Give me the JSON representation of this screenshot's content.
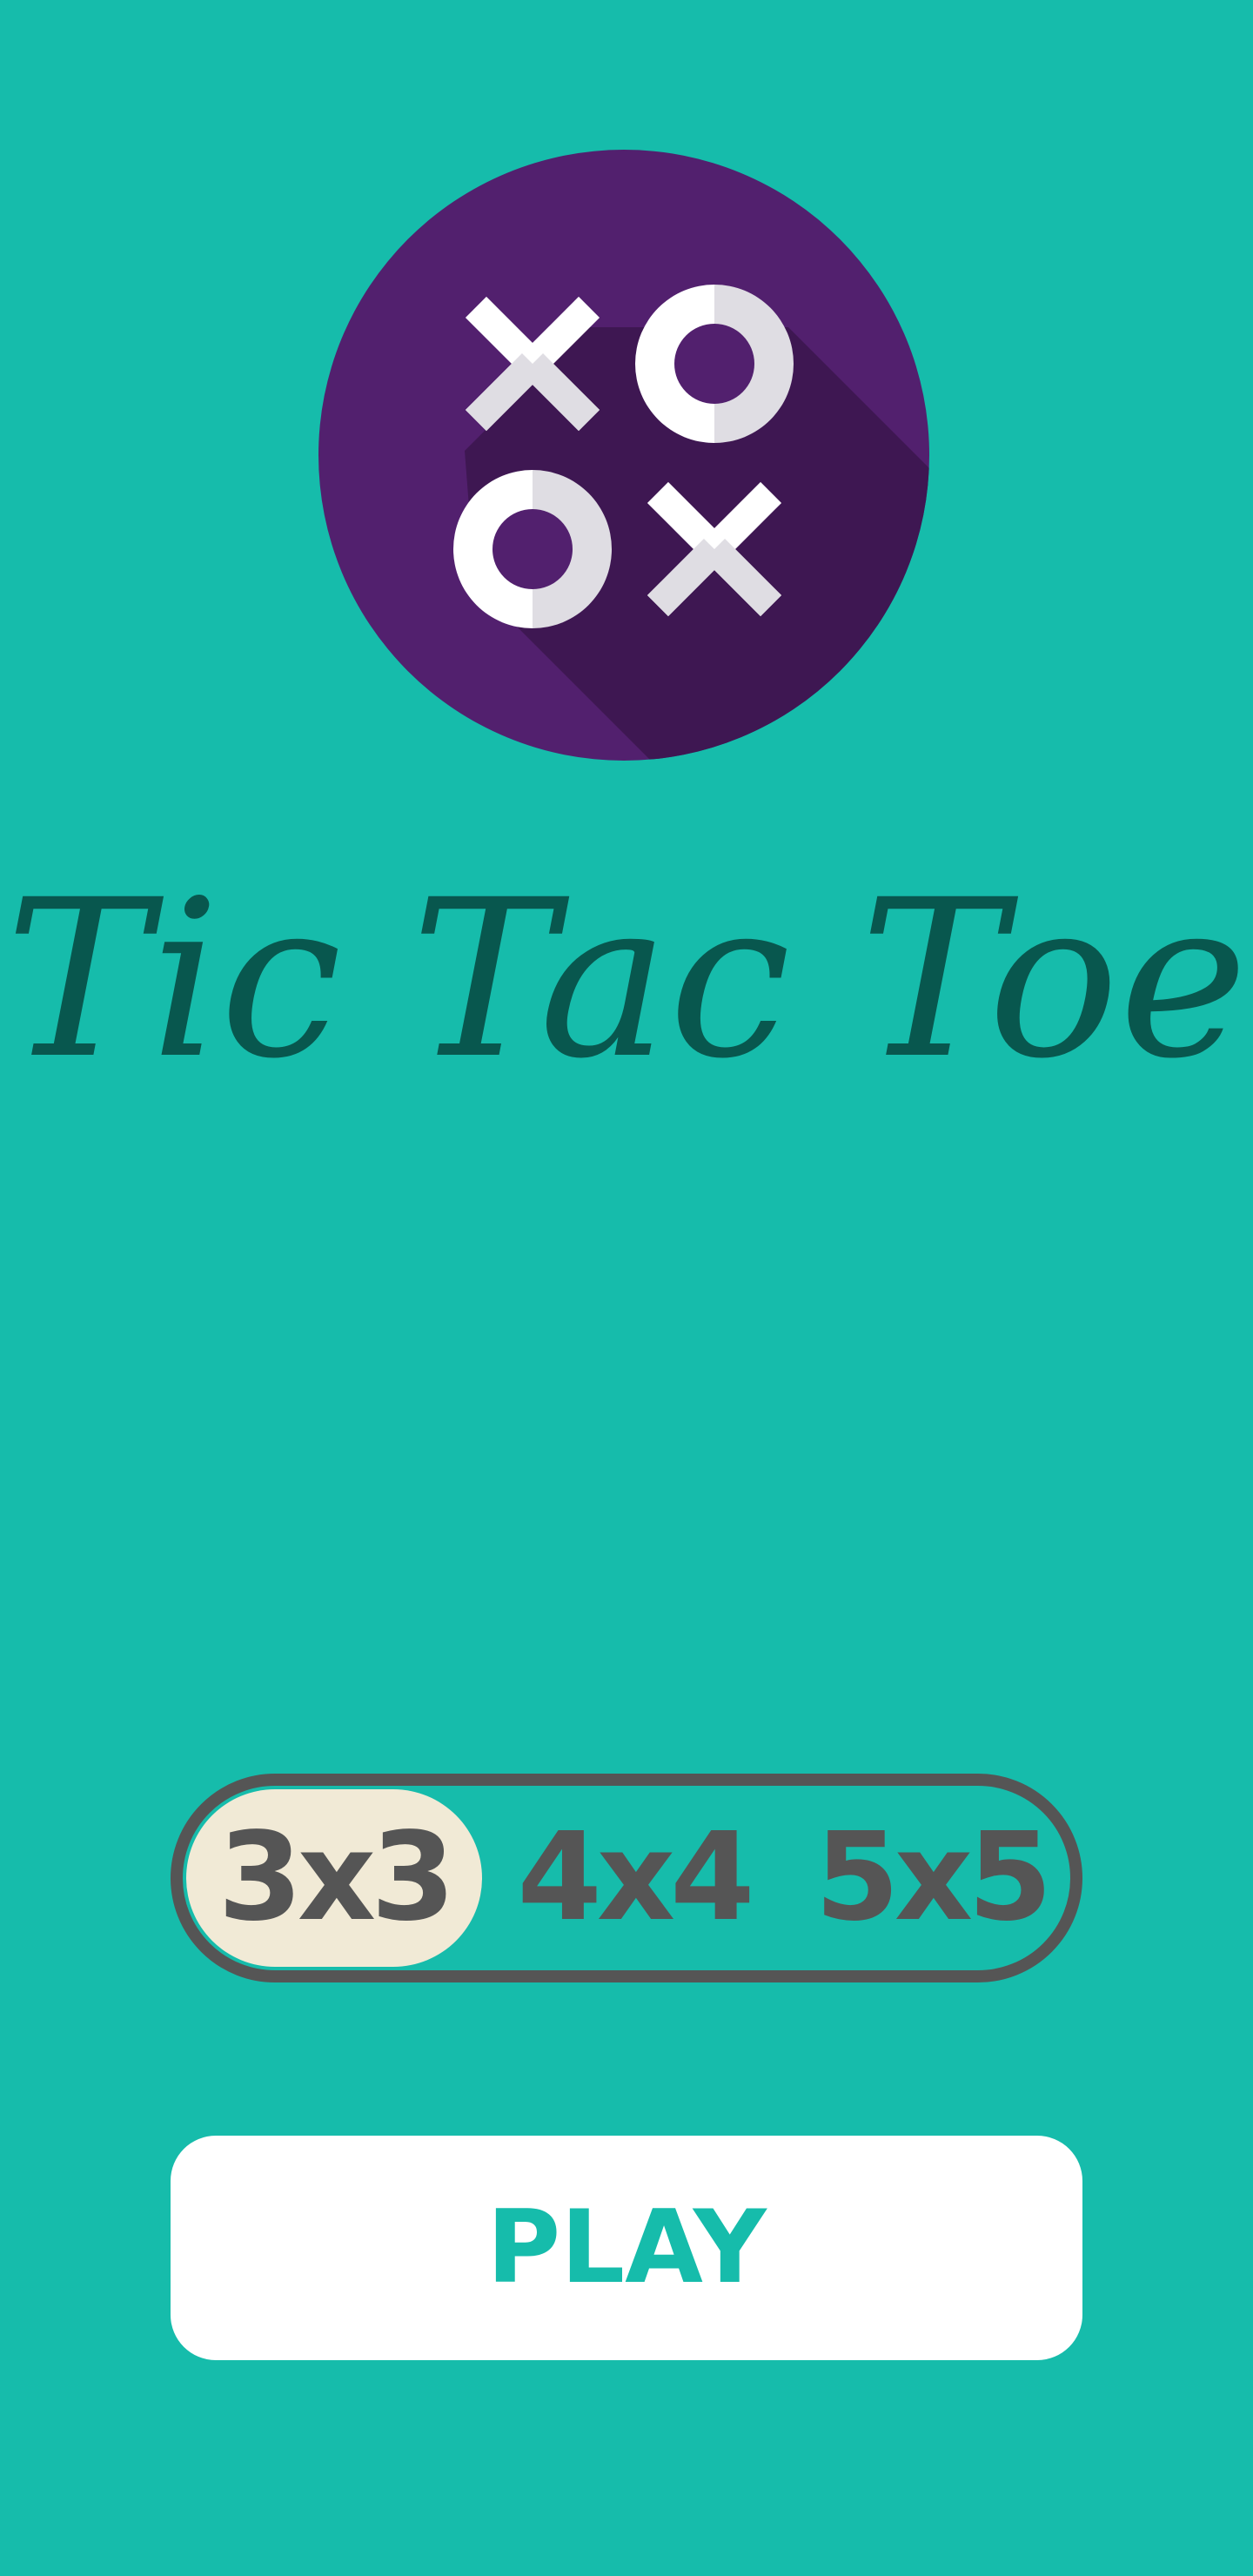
{
  "app": {
    "title": "Tic Tac Toe",
    "logo_icon": "tic-tac-toe-xo-logo-icon"
  },
  "size_selector": {
    "options": [
      "3x3",
      "4x4",
      "5x5"
    ],
    "selected": "3x3"
  },
  "play_button": {
    "label": "PLAY"
  },
  "colors": {
    "background": "#16bcab",
    "logo_circle": "#52206e",
    "logo_shadow": "#3e1752",
    "title_text": "#08574e",
    "selector_border": "#555555",
    "selected_option": "#f1ead6",
    "play_text": "#16bcab"
  }
}
